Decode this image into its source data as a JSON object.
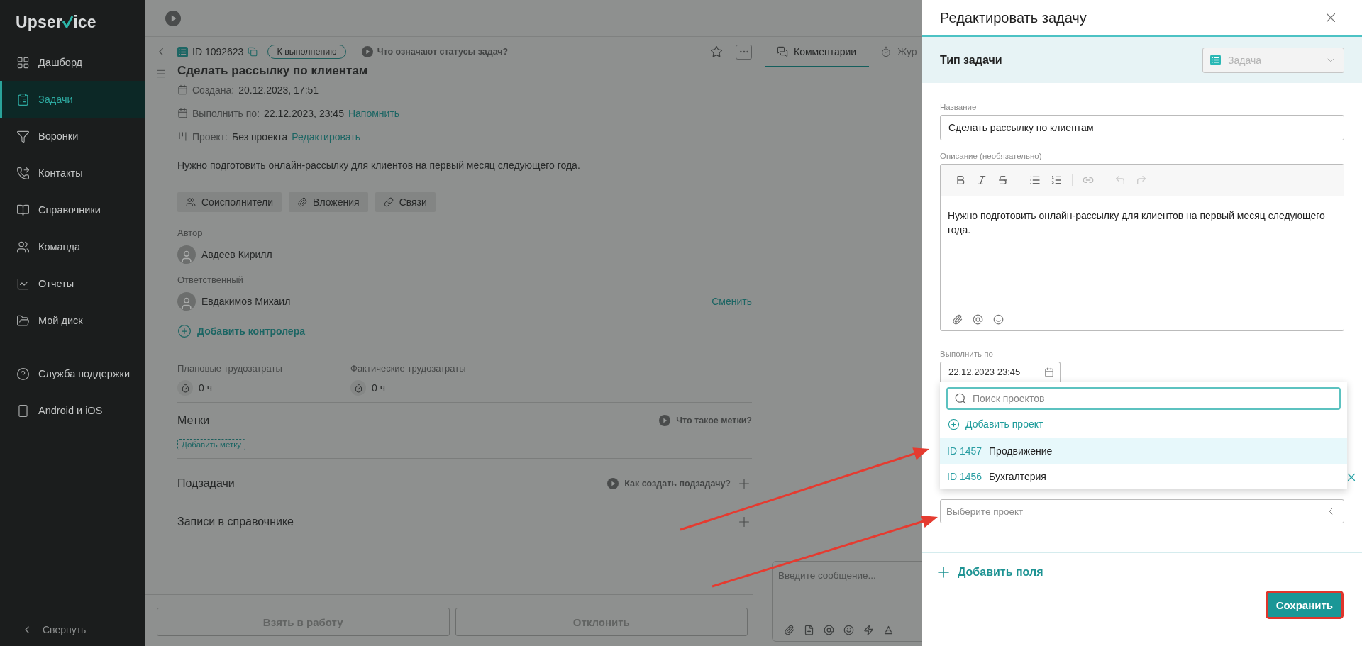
{
  "sidebar": {
    "logo": [
      "Upser",
      "ice"
    ],
    "items": [
      {
        "label": "Дашборд",
        "selected": false
      },
      {
        "label": "Задачи",
        "selected": true
      },
      {
        "label": "Воронки",
        "selected": false
      },
      {
        "label": "Контакты",
        "selected": false
      },
      {
        "label": "Справочники",
        "selected": false
      },
      {
        "label": "Команда",
        "selected": false
      },
      {
        "label": "Отчеты",
        "selected": false
      },
      {
        "label": "Мой диск",
        "selected": false
      }
    ],
    "support_items": [
      {
        "label": "Служба поддержки",
        "selected": false
      },
      {
        "label": "Android и iOS",
        "selected": false
      }
    ],
    "collapse": "Свернуть"
  },
  "task": {
    "id": "ID 1092623",
    "status": "К выполнению",
    "status_help": "Что означают статусы задач?",
    "title": "Сделать рассылку по клиентам",
    "meta": [
      {
        "label": "Создана:",
        "value": "20.12.2023, 17:51"
      },
      {
        "label": "Выполнить по:",
        "value": "22.12.2023, 23:45",
        "link": "Напомнить"
      },
      {
        "label": "Проект:",
        "value": "Без проекта",
        "link": "Редактировать"
      }
    ],
    "description": "Нужно подготовить онлайн-рассылку для клиентов на первый месяц следующего года.",
    "actions": [
      "Соисполнители",
      "Вложения",
      "Связи"
    ],
    "author": {
      "label": "Автор",
      "name": "Авдеев Кирилл"
    },
    "responsible": {
      "label": "Ответственный",
      "name": "Евдакимов Михаил",
      "action": "Сменить"
    },
    "add_controller": "Добавить контролера",
    "efforts": [
      {
        "label": "Плановые трудозатраты",
        "value": "0 ч"
      },
      {
        "label": "Фактические трудозатраты",
        "value": "0 ч"
      }
    ],
    "tags": {
      "title": "Метки",
      "help": "Что такое метки?",
      "add": "Добавить метку"
    },
    "subtasks": {
      "title": "Подзадачи",
      "help": "Как создать подзадачу?"
    },
    "directory": {
      "title": "Записи в справочнике"
    },
    "footer_buttons": [
      "Взять в работу",
      "Отклонить"
    ]
  },
  "comments": {
    "tabs": [
      {
        "label": "Комментарии",
        "selected": true
      },
      {
        "label": "Жур",
        "selected": false
      }
    ],
    "placeholder": "Введите сообщение..."
  },
  "edit_panel": {
    "title": "Редактировать задачу",
    "type_label": "Тип задачи",
    "type_value": "Задача",
    "name_label": "Название",
    "name_value": "Сделать рассылку по клиентам",
    "description_label": "Описание (необязательно)",
    "description_value": "Нужно подготовить онлайн-рассылку для клиентов на первый месяц следующего года.",
    "due_label": "Выполнить по",
    "due_value": "22.12.2023 23:45",
    "project_search_placeholder": "Поиск проектов",
    "add_project": "Добавить проект",
    "projects": [
      {
        "id": "ID 1457",
        "name": "Продвижение",
        "selected": true
      },
      {
        "id": "ID 1456",
        "name": "Бухгалтерия",
        "selected": false
      }
    ],
    "project_placeholder": "Выберите проект",
    "add_fields": "Добавить поля",
    "save": "Сохранить"
  }
}
